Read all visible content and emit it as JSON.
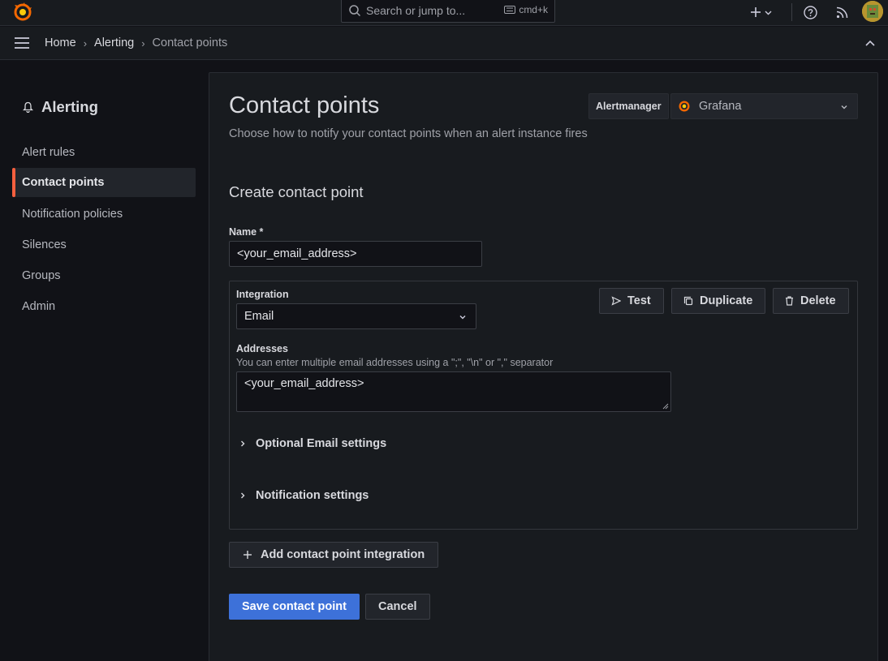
{
  "colors": {
    "accent": "#f55f3e",
    "primary_button": "#3d71d9",
    "background": "#111217",
    "panel": "#181b1f"
  },
  "topbar": {
    "logo_icon": "grafana-logo-icon",
    "search": {
      "placeholder": "Search or jump to...",
      "shortcut": "cmd+k"
    },
    "icons": [
      "plus-icon",
      "chevron-down-icon",
      "help-icon",
      "rss-icon"
    ]
  },
  "breadcrumb": {
    "items": [
      "Home",
      "Alerting",
      "Contact points"
    ]
  },
  "sidebar": {
    "title": "Alerting",
    "items": [
      {
        "label": "Alert rules",
        "active": false
      },
      {
        "label": "Contact points",
        "active": true
      },
      {
        "label": "Notification policies",
        "active": false
      },
      {
        "label": "Silences",
        "active": false
      },
      {
        "label": "Groups",
        "active": false
      },
      {
        "label": "Admin",
        "active": false
      }
    ]
  },
  "main": {
    "title": "Contact points",
    "subtitle": "Choose how to notify your contact points when an alert instance fires",
    "alertmanager": {
      "label": "Alertmanager",
      "value": "Grafana"
    },
    "form_title": "Create contact point",
    "name": {
      "label": "Name *",
      "value": "<your_email_address>"
    },
    "integration": {
      "label": "Integration",
      "value": "Email",
      "buttons": {
        "test": "Test",
        "duplicate": "Duplicate",
        "delete": "Delete"
      },
      "addresses": {
        "label": "Addresses",
        "description": "You can enter multiple email addresses using a \";\", \"\\n\" or \",\" separator",
        "value": "<your_email_address>"
      },
      "optional_settings": "Optional Email settings",
      "notification_settings": "Notification settings"
    },
    "add_integration_label": "Add contact point integration",
    "save_label": "Save contact point",
    "cancel_label": "Cancel"
  }
}
